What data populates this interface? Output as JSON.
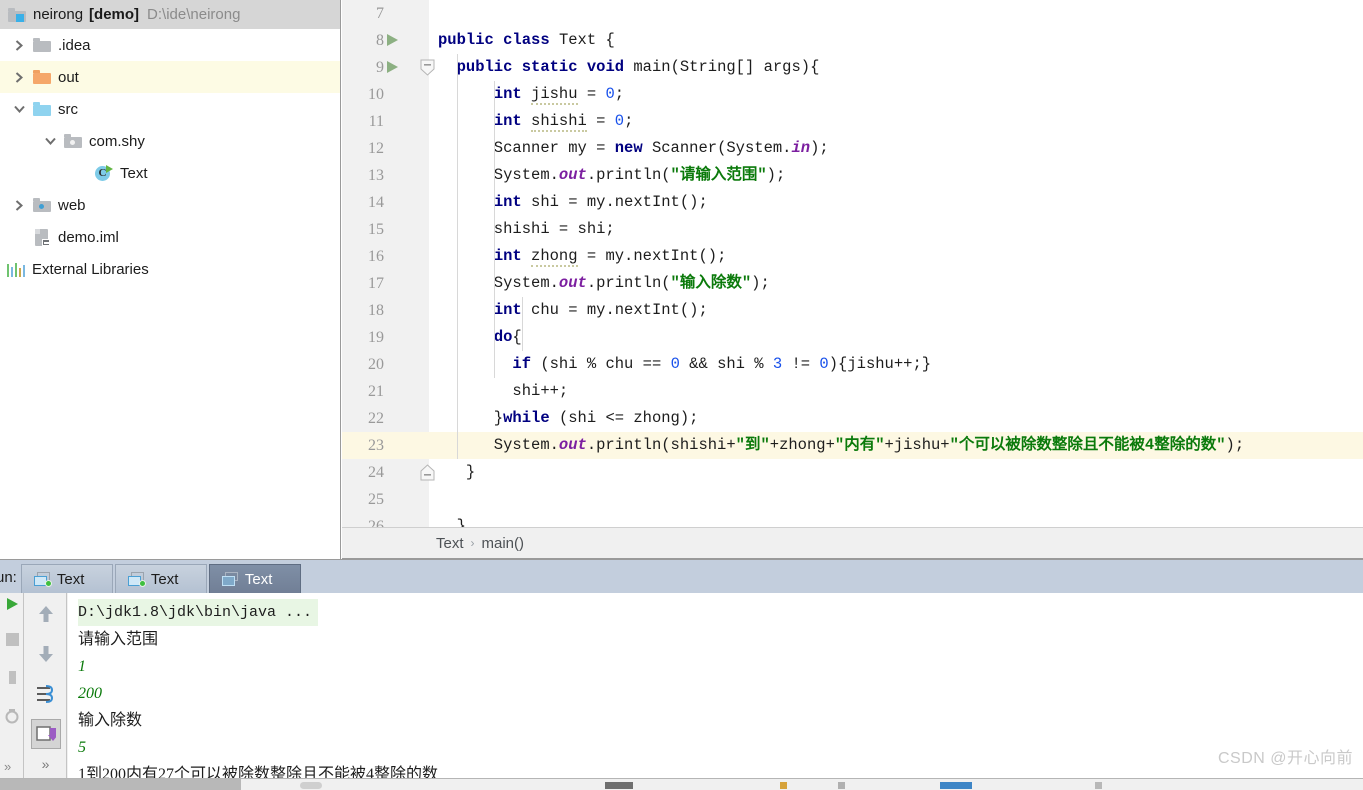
{
  "project": {
    "header": {
      "icon": "module-folder-icon",
      "name": "neirong",
      "module": "[demo]",
      "path": "D:\\ide\\neirong"
    },
    "tree": [
      {
        "label": ".idea",
        "indent": 0,
        "arrow": "chevron-right",
        "icon": "folder-grey-icon",
        "highlight": false
      },
      {
        "label": "out",
        "indent": 0,
        "arrow": "chevron-right",
        "icon": "folder-orange-icon",
        "highlight": true
      },
      {
        "label": "src",
        "indent": 0,
        "arrow": "chevron-down",
        "icon": "folder-blue-icon",
        "highlight": false
      },
      {
        "label": "com.shy",
        "indent": 1,
        "arrow": "chevron-down",
        "icon": "package-icon",
        "highlight": false
      },
      {
        "label": "Text",
        "indent": 2,
        "arrow": "none",
        "icon": "java-class-icon",
        "highlight": false
      },
      {
        "label": "web",
        "indent": 0,
        "arrow": "chevron-right",
        "icon": "web-folder-icon",
        "highlight": false
      },
      {
        "label": "demo.iml",
        "indent": 0,
        "arrow": "none",
        "icon": "iml-file-icon",
        "highlight": false
      },
      {
        "label": "External Libraries",
        "indent": -1,
        "arrow": "none",
        "icon": "libraries-icon",
        "highlight": false
      }
    ]
  },
  "editor": {
    "first_line": 7,
    "current_line": 23,
    "run_marker_lines": [
      8,
      9
    ],
    "lines": [
      {
        "n": 7,
        "tokens": []
      },
      {
        "n": 8,
        "tokens": [
          {
            "t": "public ",
            "c": "kw"
          },
          {
            "t": "class ",
            "c": "kw"
          },
          {
            "t": "Text {",
            "c": ""
          }
        ]
      },
      {
        "n": 9,
        "tokens": [
          {
            "t": "  public ",
            "c": "kw"
          },
          {
            "t": "static ",
            "c": "kw"
          },
          {
            "t": "void ",
            "c": "kw"
          },
          {
            "t": "main(String[] args){",
            "c": ""
          }
        ]
      },
      {
        "n": 10,
        "tokens": [
          {
            "t": "      ",
            "c": ""
          },
          {
            "t": "int ",
            "c": "kw"
          },
          {
            "t": "jishu",
            "c": "warnvar"
          },
          {
            "t": " = ",
            "c": ""
          },
          {
            "t": "0",
            "c": "num-lit"
          },
          {
            "t": ";",
            "c": ""
          }
        ]
      },
      {
        "n": 11,
        "tokens": [
          {
            "t": "      ",
            "c": ""
          },
          {
            "t": "int ",
            "c": "kw"
          },
          {
            "t": "shishi",
            "c": "warnvar"
          },
          {
            "t": " = ",
            "c": ""
          },
          {
            "t": "0",
            "c": "num-lit"
          },
          {
            "t": ";",
            "c": ""
          }
        ]
      },
      {
        "n": 12,
        "tokens": [
          {
            "t": "      Scanner my = ",
            "c": ""
          },
          {
            "t": "new ",
            "c": "kw"
          },
          {
            "t": "Scanner(System.",
            "c": ""
          },
          {
            "t": "in",
            "c": "fld"
          },
          {
            "t": ");",
            "c": ""
          }
        ]
      },
      {
        "n": 13,
        "tokens": [
          {
            "t": "      System.",
            "c": ""
          },
          {
            "t": "out",
            "c": "fld"
          },
          {
            "t": ".println(",
            "c": ""
          },
          {
            "t": "\"请输入范围\"",
            "c": "str"
          },
          {
            "t": ");",
            "c": ""
          }
        ]
      },
      {
        "n": 14,
        "tokens": [
          {
            "t": "      ",
            "c": ""
          },
          {
            "t": "int ",
            "c": "kw"
          },
          {
            "t": "shi = my.nextInt();",
            "c": ""
          }
        ]
      },
      {
        "n": 15,
        "tokens": [
          {
            "t": "      shishi = shi;",
            "c": ""
          }
        ]
      },
      {
        "n": 16,
        "tokens": [
          {
            "t": "      ",
            "c": ""
          },
          {
            "t": "int ",
            "c": "kw"
          },
          {
            "t": "zhong",
            "c": "warnvar"
          },
          {
            "t": " = my.nextInt();",
            "c": ""
          }
        ]
      },
      {
        "n": 17,
        "tokens": [
          {
            "t": "      System.",
            "c": ""
          },
          {
            "t": "out",
            "c": "fld"
          },
          {
            "t": ".println(",
            "c": ""
          },
          {
            "t": "\"输入除数\"",
            "c": "str"
          },
          {
            "t": ");",
            "c": ""
          }
        ]
      },
      {
        "n": 18,
        "tokens": [
          {
            "t": "      ",
            "c": ""
          },
          {
            "t": "int ",
            "c": "kw"
          },
          {
            "t": "chu = my.nextInt();",
            "c": ""
          }
        ]
      },
      {
        "n": 19,
        "tokens": [
          {
            "t": "      ",
            "c": ""
          },
          {
            "t": "do",
            "c": "kw"
          },
          {
            "t": "{",
            "c": ""
          }
        ]
      },
      {
        "n": 20,
        "tokens": [
          {
            "t": "        ",
            "c": ""
          },
          {
            "t": "if",
            "c": "kw"
          },
          {
            "t": " (shi % chu == ",
            "c": ""
          },
          {
            "t": "0",
            "c": "num-lit"
          },
          {
            "t": " && shi % ",
            "c": ""
          },
          {
            "t": "3",
            "c": "num-lit"
          },
          {
            "t": " != ",
            "c": ""
          },
          {
            "t": "0",
            "c": "num-lit"
          },
          {
            "t": "){jishu++;}",
            "c": ""
          }
        ]
      },
      {
        "n": 21,
        "tokens": [
          {
            "t": "        shi++;",
            "c": ""
          }
        ]
      },
      {
        "n": 22,
        "tokens": [
          {
            "t": "      }",
            "c": ""
          },
          {
            "t": "while",
            "c": "kw"
          },
          {
            "t": " (shi <= zhong);",
            "c": ""
          }
        ]
      },
      {
        "n": 23,
        "tokens": [
          {
            "t": "      System.",
            "c": ""
          },
          {
            "t": "out",
            "c": "fld"
          },
          {
            "t": ".println(shishi+",
            "c": ""
          },
          {
            "t": "\"到\"",
            "c": "str"
          },
          {
            "t": "+zhong+",
            "c": ""
          },
          {
            "t": "\"内有\"",
            "c": "str"
          },
          {
            "t": "+jishu+",
            "c": ""
          },
          {
            "t": "\"个可以被除数整除且不能被4整除的数\"",
            "c": "str"
          },
          {
            "t": ");",
            "c": ""
          }
        ]
      },
      {
        "n": 24,
        "tokens": [
          {
            "t": "   }",
            "c": ""
          }
        ]
      },
      {
        "n": 25,
        "tokens": []
      },
      {
        "n": 26,
        "tokens": [
          {
            "t": "  }",
            "c": ""
          }
        ]
      }
    ]
  },
  "breadcrumb": {
    "class": "Text",
    "separator": "›",
    "method": "main()"
  },
  "run_panel": {
    "label": "un:",
    "tabs": [
      {
        "label": "Text",
        "active": false,
        "icon": "run-config-icon"
      },
      {
        "label": "Text",
        "active": false,
        "icon": "run-config-icon"
      },
      {
        "label": "Text",
        "active": true,
        "icon": "run-config-icon"
      }
    ],
    "left_rail_icons": [
      "rerun-icon",
      "stop-icon",
      "pause-icon",
      "dump-threads-icon"
    ],
    "left_rail_more": "»",
    "toolbar_icons": [
      "up-arrow-icon",
      "down-arrow-icon",
      "soft-wrap-icon",
      "scroll-to-end-icon"
    ],
    "toolbar_more": "»",
    "console": [
      {
        "text": "D:\\jdk1.8\\jdk\\bin\\java ...",
        "style": "cmd"
      },
      {
        "text": "请输入范围",
        "style": "zh"
      },
      {
        "text": "1",
        "style": "input"
      },
      {
        "text": "200",
        "style": "input"
      },
      {
        "text": "输入除数",
        "style": "zh"
      },
      {
        "text": "5",
        "style": "input"
      },
      {
        "text": "1到200内有27个可以被除数整除且不能被4整除的数",
        "style": "zh"
      }
    ]
  },
  "watermark": {
    "text": "CSDN @开心向前"
  },
  "colors": {
    "keyword": "#000080",
    "string": "#0b7a0b",
    "number": "#1750eb",
    "field": "#7c1fa0",
    "current_line": "#fdf8e3",
    "tree_highlight": "#fdfbe4",
    "run_tabbar": "#c3cedd",
    "active_tab": "#7f8fa6",
    "folder_orange": "#f0a060",
    "folder_blue": "#8fd3ef",
    "folder_grey": "#b9bcc0",
    "run_marker": "#7aa46f"
  }
}
